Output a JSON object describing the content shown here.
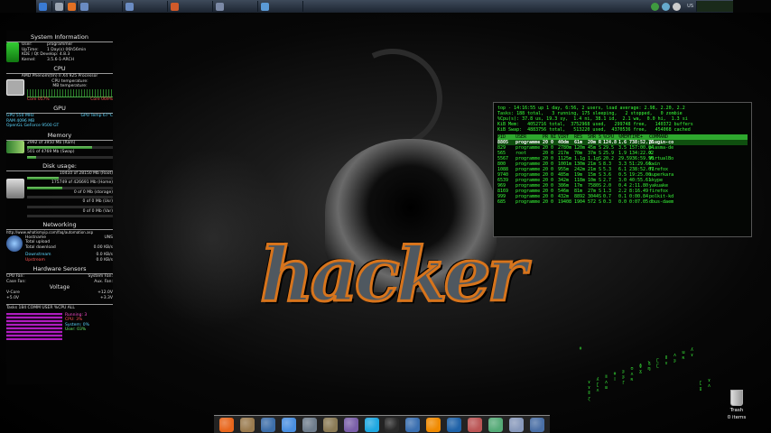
{
  "colors": {
    "accent": "#39ff39",
    "logo_outline": "#d7741c",
    "panel": "#2b3644"
  },
  "panel": {
    "apps": [
      {
        "icon": "kde-menu-icon",
        "label": "",
        "color": "#3a7bd5"
      },
      {
        "icon": "konsole-icon",
        "label": "",
        "color": "#9aa4b2"
      },
      {
        "icon": "browser-icon",
        "label": "",
        "color": "#e27023"
      },
      {
        "icon": "window-icon",
        "label": "",
        "color": "#6a8bc2"
      },
      {
        "icon": "window-icon",
        "label": "",
        "color": "#6a8bc2"
      },
      {
        "icon": "window-icon",
        "label": "",
        "color": "#d15a2a"
      },
      {
        "icon": "window-icon",
        "label": "",
        "color": "#7b89a6"
      },
      {
        "icon": "window-icon",
        "label": "",
        "color": "#5a9ad6"
      }
    ],
    "tray": [
      "network-icon",
      "music-icon",
      "volume-icon"
    ],
    "keyboard_layout": "US",
    "clock_time": "",
    "clock_date": ""
  },
  "sysmon": {
    "system_info": {
      "title": "System Information",
      "user_label": "User:",
      "user": "programmer",
      "uptime_label": "UpTime:",
      "uptime": "1 Day(s) 06h56min",
      "kde_label": "KDE / Qt Develop:",
      "kde": "4.8.3",
      "kernel_label": "Kernel:",
      "kernel": "3.5.6-1-ARCH"
    },
    "cpu": {
      "title": "CPU",
      "model": "AMD Phenom(tm) II X4 925 Processor",
      "temp_label": "CPU temperature:",
      "mb_label": "MB temperature:",
      "core1": "Core 057%",
      "core2": "Core 069%"
    },
    "gpu": {
      "title": "GPU",
      "gpu_freq": "GPU 550 MHz",
      "gpu_temp": "GPU Temp 67°C",
      "ram_label": "RAM 4096 MB",
      "opengl_label": "OpenGL GeForce 9500 GT"
    },
    "memory": {
      "title": "Memory",
      "ram": "2992 of 3950 Mb (Ram)",
      "ram_fraction": 0.76,
      "swap": "501 of 4769 Mb (Swap)",
      "swap_fraction": 0.11
    },
    "disk": {
      "title": "Disk usage:",
      "items": [
        {
          "text": "10410 of 28150 Mb (Root)",
          "fraction": 0.37
        },
        {
          "text": "175749 of 426691 Mb (Home)",
          "fraction": 0.41
        },
        {
          "text": "0 of 0 Mb (storage)",
          "fraction": 0.0
        },
        {
          "text": "0 of 0 Mb (Usr)",
          "fraction": 0.0
        },
        {
          "text": "0 of 0 Mb (Var)",
          "fraction": 0.0
        }
      ]
    },
    "network": {
      "title": "Networking",
      "url": "http://www.whatismyip.com/faq/automation.asp",
      "hostname_label": "Hostname",
      "hostname": "UNS",
      "upload_label": "Total upload",
      "download_label": "Total download",
      "upload": "0.00 KB/s",
      "downstream_label": "Downstream",
      "downstream": "0.0 KB/s",
      "upstream_label": "Upstream",
      "upstream": "0.0 KB/s"
    },
    "sensors": {
      "title": "Hardware Sensors",
      "cpu_fan_label": "CPU Fan:",
      "system_fan_label": "System Fan:",
      "case_fan_label": "Case Fan:",
      "aux_fan_label": "Aux. Fan:",
      "voltage_title": "Voltage",
      "vcore_label": "V-Core",
      "v12": "+12.0V",
      "v5": "+5.0V",
      "v33": "+3.3V"
    },
    "tasks": {
      "header": "Tasks  184  COMM  USER  %CPU  ALL",
      "running": "Running: 3",
      "cpu_label": "CPU: 3%",
      "system_label": "System: 0%",
      "user_label": "User: 03%"
    }
  },
  "terminal": {
    "line1": "top - 14:16:55 up 1 day, 6:56, 2 users, load average: 2.98, 2.20, 2.2",
    "line2": "Tasks: 188 total,   3 running, 175 sleeping,   2 stopped,   0 zombie",
    "line3": "%Cpu(s): 37.8 us, 19.3 sy,  1.4 ni, 38.1 id,  2.1 wa,  0.0 hi,  1.3 si",
    "line4": "KiB Mem:   4052716 total,  3752968 used,   299748 free,   140372 buffers",
    "line5": "KiB Swap:  4883756 total,   513220 used,  4370536 free,   454068 cached",
    "headers": [
      "PID",
      "USER",
      "PR",
      "NI",
      "VIRT",
      "RES",
      "SHR",
      "S",
      "%CPU",
      "%MEM",
      "TIME+",
      "COMMAND"
    ],
    "rows": [
      [
        "8805",
        "programme",
        "20",
        "0",
        "40dm",
        "61m",
        "20m",
        "R",
        "124.8",
        "1.6",
        "738:52.75",
        "plugin-co"
      ],
      [
        "829",
        "programme",
        "20",
        "0",
        "2780m",
        "120m",
        "45m",
        "S",
        "29.5",
        "3.5",
        "157:00.04",
        "plasma-de"
      ],
      [
        "565",
        "root",
        "20",
        "0",
        "217m",
        "70m",
        "37m",
        "S",
        "25.9",
        "1.9",
        "134:22.02",
        "X"
      ],
      [
        "5567",
        "programme",
        "20",
        "0",
        "1125m",
        "1.1g",
        "1.1g",
        "S",
        "20.2",
        "29.5",
        "936:59.96",
        "VirtualBo"
      ],
      [
        "800",
        "programme",
        "20",
        "0",
        "1001m",
        "130m",
        "21m",
        "S",
        "8.3",
        "3.3",
        "51:29.66",
        "kwin"
      ],
      [
        "1088",
        "programme",
        "20",
        "0",
        "955m",
        "242m",
        "21m",
        "S",
        "5.3",
        "6.1",
        "238:52.07",
        "firefox"
      ],
      [
        "9740",
        "programme",
        "20",
        "0",
        "485m",
        "19m",
        "15m",
        "S",
        "3.6",
        "0.5",
        "19:25.00",
        "superkara"
      ],
      [
        "6539",
        "programme",
        "20",
        "0",
        "342m",
        "118m",
        "10m",
        "S",
        "2.7",
        "3.0",
        "40:55.61",
        "skype"
      ],
      [
        "969",
        "programme",
        "20",
        "0",
        "386m",
        "17m",
        "7580",
        "S",
        "2.0",
        "0.4",
        "2:11.80",
        "yakuake"
      ],
      [
        "8169",
        "programme",
        "20",
        "0",
        "546m",
        "81m",
        "27m",
        "S",
        "1.3",
        "2.2",
        "8:16.49",
        "firefox"
      ],
      [
        "999",
        "programme",
        "20",
        "0",
        "432m",
        "8892",
        "3044",
        "S",
        "0.7",
        "0.1",
        "0:00.84",
        "polkit-kd"
      ],
      [
        "685",
        "programme",
        "20",
        "0",
        "19408",
        "1904",
        "572",
        "S",
        "0.3",
        "0.0",
        "0:07.05",
        "dbus-daem"
      ]
    ]
  },
  "matrix": {
    "columns": [
      "ǂ",
      "ɤɤǁɀ",
      "ʎʗʌ",
      "ʬʌɯ",
      "ǂǀ",
      "ʂʂɼ",
      "ʊʌʀ",
      "ɸɣ",
      "ɮɱ",
      "ʗʗ",
      "ǁɤ",
      "ʌʂ",
      "ɯʀ",
      "ʎɤ",
      "ʗɣ",
      "ɤʌ"
    ]
  },
  "dock": {
    "items": [
      {
        "icon": "firefox-icon",
        "color": "#e8661c"
      },
      {
        "icon": "kmail-icon",
        "color": "#9a7b4f"
      },
      {
        "icon": "thunderbird-icon",
        "color": "#3d6ea8"
      },
      {
        "icon": "chromium-icon",
        "color": "#4a8fe0"
      },
      {
        "icon": "mail-icon",
        "color": "#6f7d8c"
      },
      {
        "icon": "gimp-icon",
        "color": "#8a7a55"
      },
      {
        "icon": "pidgin-icon",
        "color": "#7a5fa8"
      },
      {
        "icon": "skype-icon",
        "color": "#1ea7e0"
      },
      {
        "icon": "terminal-icon",
        "color": "#2a2a2a"
      },
      {
        "icon": "python-icon",
        "color": "#3a6fb0"
      },
      {
        "icon": "vlc-icon",
        "color": "#f08a00"
      },
      {
        "icon": "virtualbox-icon",
        "color": "#1f62a8"
      },
      {
        "icon": "settings-icon",
        "color": "#b55"
      },
      {
        "icon": "system-monitor-icon",
        "color": "#5a7"
      },
      {
        "icon": "calendar-icon",
        "color": "#8899bb"
      },
      {
        "icon": "folder-icon",
        "color": "#4a6fa5"
      }
    ]
  },
  "trash": {
    "label_line1": "Trash",
    "label_line2": "0 items"
  }
}
